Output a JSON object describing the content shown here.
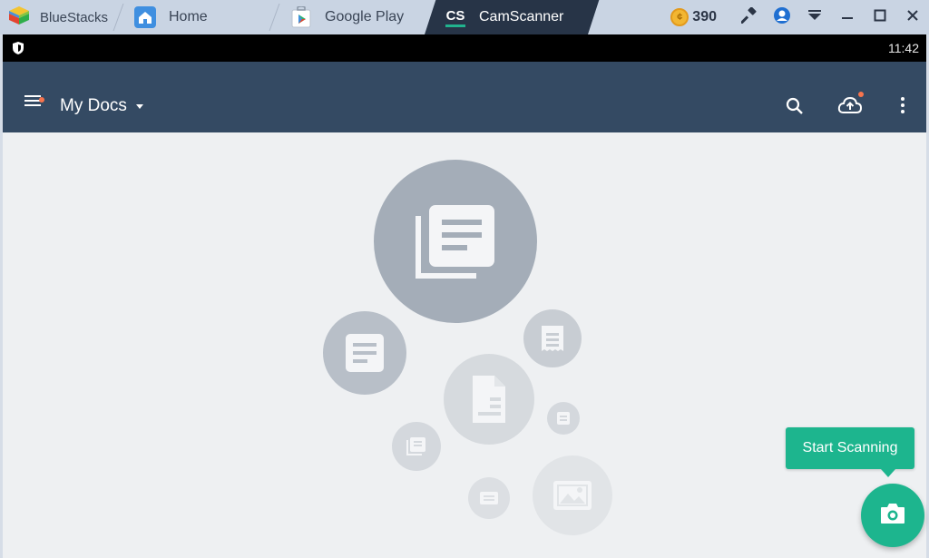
{
  "window": {
    "brand_label": "BlueStacks",
    "tabs": [
      {
        "label": "Home",
        "icon": "home-icon"
      },
      {
        "label": "Google Play",
        "icon": "google-play-icon"
      },
      {
        "label": "CamScanner",
        "icon": "camscanner-icon",
        "icon_text": "CS",
        "active": true
      }
    ],
    "coins": "390",
    "controls": [
      "hammer-icon",
      "account-icon",
      "dropdown-icon",
      "minimize-icon",
      "maximize-icon",
      "close-icon"
    ]
  },
  "statusbar": {
    "time": "11:42"
  },
  "appbar": {
    "title": "My Docs",
    "actions": [
      "search-icon",
      "cloud-upload-icon",
      "more-vert-icon"
    ]
  },
  "empty_state": {
    "illustration": "documents-illustration"
  },
  "fab": {
    "tooltip": "Start Scanning",
    "icon": "camera-icon"
  },
  "colors": {
    "accent": "#1db58e",
    "toolbar": "#344a63",
    "titlebar": "#c9d4e3",
    "notification_dot": "#f7744d"
  }
}
